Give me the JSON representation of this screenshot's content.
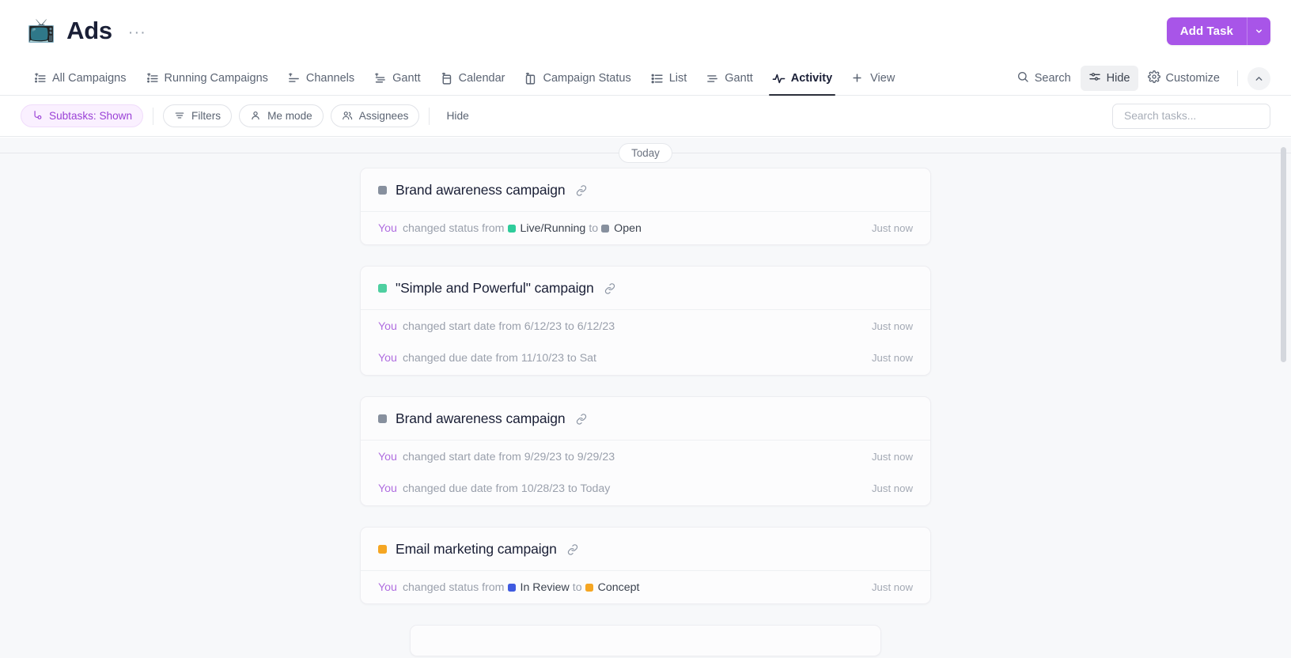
{
  "header": {
    "emoji": "📺",
    "title": "Ads",
    "more_label": "···",
    "add_task_label": "Add Task"
  },
  "tabs": [
    {
      "label": "All Campaigns",
      "icon": "pinned-list-icon",
      "active": false
    },
    {
      "label": "Running Campaigns",
      "icon": "pinned-list-icon",
      "active": false
    },
    {
      "label": "Channels",
      "icon": "pinned-board-icon",
      "active": false
    },
    {
      "label": "Gantt",
      "icon": "pinned-gantt-icon",
      "active": false
    },
    {
      "label": "Calendar",
      "icon": "pinned-calendar-icon",
      "active": false
    },
    {
      "label": "Campaign Status",
      "icon": "pinned-columns-icon",
      "active": false
    },
    {
      "label": "List",
      "icon": "list-icon",
      "active": false
    },
    {
      "label": "Gantt",
      "icon": "gantt-icon",
      "active": false
    },
    {
      "label": "Activity",
      "icon": "activity-icon",
      "active": true
    }
  ],
  "add_view": {
    "label": "View"
  },
  "tab_actions": {
    "search_label": "Search",
    "hide_label": "Hide",
    "customize_label": "Customize"
  },
  "filterbar": {
    "subtasks_label": "Subtasks: Shown",
    "filters_label": "Filters",
    "me_mode_label": "Me mode",
    "assignees_label": "Assignees",
    "hide_label": "Hide"
  },
  "search": {
    "placeholder": "Search tasks...",
    "value": ""
  },
  "activity": {
    "divider_label": "Today",
    "actor_label": "You",
    "cards": [
      {
        "title": "Brand awareness campaign",
        "status_color": "#87909e",
        "rows": [
          {
            "type": "status",
            "prefix": "changed status from",
            "from_label": "Live/Running",
            "from_color": "#2ecc9b",
            "middle": "to",
            "to_label": "Open",
            "to_color": "#87909e",
            "time": "Just now"
          }
        ]
      },
      {
        "title": "\"Simple and Powerful\" campaign",
        "status_color": "#4ecfa0",
        "rows": [
          {
            "type": "text",
            "prefix": "changed start date from 6/12/23 to 6/12/23",
            "time": "Just now"
          },
          {
            "type": "text",
            "prefix": "changed due date from 11/10/23 to Sat",
            "time": "Just now"
          }
        ]
      },
      {
        "title": "Brand awareness campaign",
        "status_color": "#87909e",
        "rows": [
          {
            "type": "text",
            "prefix": "changed start date from 9/29/23 to 9/29/23",
            "time": "Just now"
          },
          {
            "type": "text",
            "prefix": "changed due date from 10/28/23 to Today",
            "time": "Just now"
          }
        ]
      },
      {
        "title": "Email marketing campaign",
        "status_color": "#f5a623",
        "rows": [
          {
            "type": "status",
            "prefix": "changed status from",
            "from_label": "In Review",
            "from_color": "#3f5ae0",
            "middle": "to",
            "to_label": "Concept",
            "to_color": "#f5a623",
            "time": "Just now"
          }
        ]
      }
    ]
  },
  "colors": {
    "accent_purple": "#a855e8",
    "actor_purple": "#b06ee0",
    "body_bg": "#f7f8fa"
  }
}
